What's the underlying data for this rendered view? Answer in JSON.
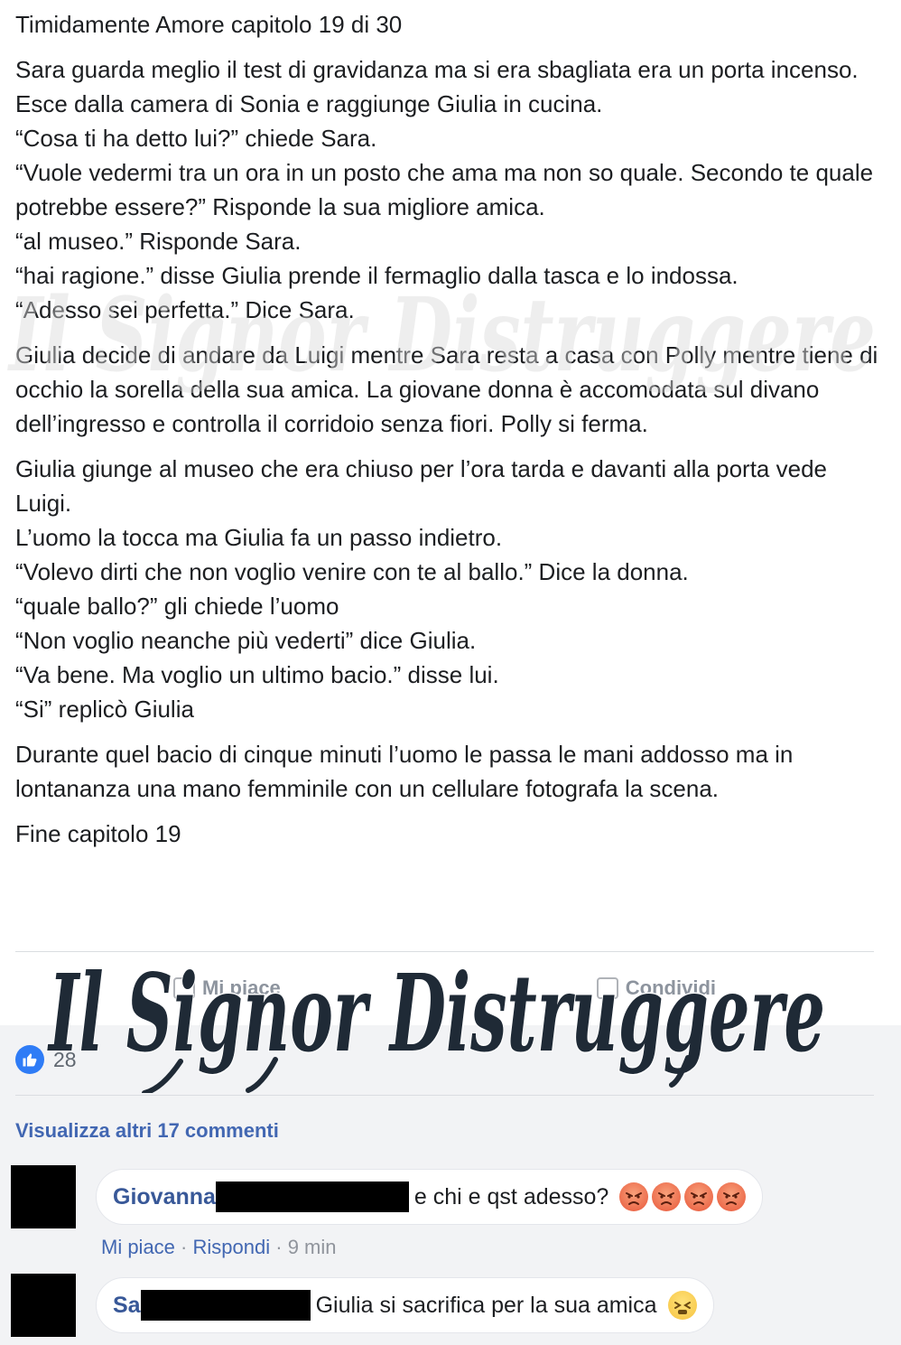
{
  "post": {
    "title": "Timidamente Amore capitolo 19 di 30",
    "paragraphs": [
      {
        "lines": [
          "Sara guarda meglio il test di gravidanza ma si era sbagliata era un porta incenso.",
          "Esce dalla camera di Sonia e raggiunge Giulia in cucina.",
          "“Cosa ti ha detto lui?” chiede Sara.",
          "“Vuole vedermi tra un ora in un posto che ama ma non so quale. Secondo te quale potrebbe essere?” Risponde la sua migliore amica.",
          "“al museo.” Risponde Sara.",
          "“hai ragione.” disse Giulia prende il fermaglio dalla tasca e lo indossa.",
          "“Adesso sei perfetta.” Dice Sara."
        ]
      },
      {
        "lines": [
          "Giulia decide di andare da Luigi mentre Sara resta a casa con Polly mentre tiene di occhio la sorella della sua amica. La giovane donna è accomodata sul divano dell’ingresso e controlla il corridoio senza fiori. Polly si ferma."
        ]
      },
      {
        "lines": [
          "Giulia giunge al museo che era chiuso per l’ora tarda e davanti alla porta vede Luigi.",
          "L’uomo la tocca ma Giulia fa un passo indietro.",
          "“Volevo dirti che non voglio venire con te al ballo.” Dice la donna.",
          "“quale ballo?” gli chiede l’uomo",
          "“Non voglio neanche più vederti” dice Giulia.",
          "“Va bene. Ma voglio un ultimo bacio.” disse lui.",
          "“Si” replicò Giulia"
        ]
      },
      {
        "lines": [
          "Durante quel bacio di cinque minuti l’uomo le passa le mani addosso ma in lontananza una mano femminile con un cellulare fotografa la scena."
        ]
      },
      {
        "lines": [
          "Fine capitolo 19"
        ]
      }
    ]
  },
  "watermark": {
    "text": "Il Signor Distruggere",
    "color": "#1f2a36"
  },
  "actions": {
    "like_label": "Mi piace",
    "share_label": "Condividi"
  },
  "feedback": {
    "like_count": "28",
    "more_comments": "Visualizza altri 17 commenti"
  },
  "comments": [
    {
      "author": "Giovanna",
      "text": "e chi e qst adesso?",
      "emojis": [
        "angry-face",
        "angry-face",
        "angry-face",
        "angry-face"
      ],
      "like_label": "Mi piace",
      "reply_label": "Rispondi",
      "time": "9 min"
    },
    {
      "author": "Sa",
      "text": "Giulia si sacrifica per la sua amica",
      "emojis": [
        "tired-face"
      ]
    }
  ],
  "colors": {
    "link_blue": "#4267b2",
    "author_blue": "#385898",
    "like_blue": "#2f7cf6",
    "feedback_bg": "#f2f3f5"
  }
}
